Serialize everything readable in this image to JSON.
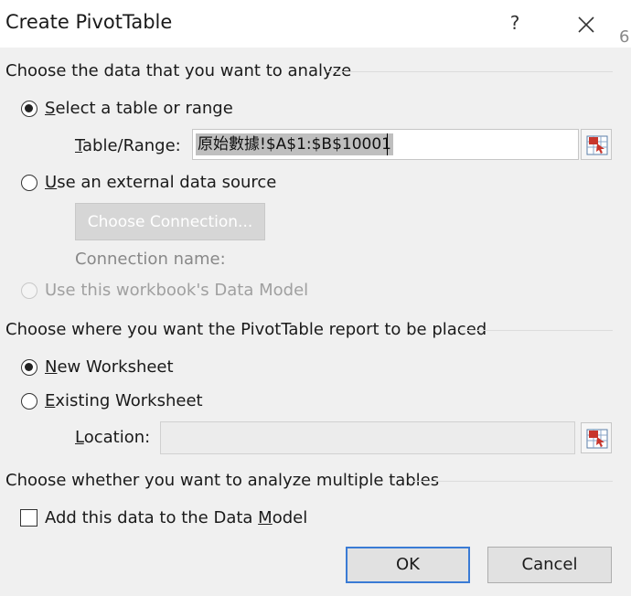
{
  "dialog": {
    "title": "Create PivotTable",
    "help_glyph": "?",
    "edge_glyph": "6"
  },
  "analyze_section": {
    "heading": "Choose the data that you want to analyze",
    "option_table": {
      "ak": "S",
      "rest": "elect a table or range",
      "selected": true
    },
    "range_label": {
      "ak": "T",
      "rest": "able/Range:"
    },
    "range_value": "原始數據!$A$1:$B$10001",
    "option_external": {
      "pre": "",
      "ak": "U",
      "rest": "se an external data source",
      "selected": false
    },
    "connection_button": "Choose Connection...",
    "connection_name_label": "Connection name:",
    "option_data_model": {
      "label": "Use this workbook's Data Model",
      "enabled": false
    }
  },
  "placement_section": {
    "heading": "Choose where you want the PivotTable report to be placed",
    "option_new": {
      "ak": "N",
      "rest": "ew Worksheet",
      "selected": true
    },
    "option_existing": {
      "ak": "E",
      "rest": "xisting Worksheet",
      "selected": false
    },
    "location_label": {
      "ak": "L",
      "rest": "ocation:"
    },
    "location_value": ""
  },
  "multiple_section": {
    "heading": "Choose whether you want to analyze multiple tables",
    "checkbox_pre": "Add this data to the Data ",
    "checkbox_ak": "M",
    "checkbox_rest": "odel",
    "checked": false
  },
  "buttons": {
    "ok": "OK",
    "cancel": "Cancel"
  },
  "colors": {
    "accent": "#3a7bd5",
    "background": "#f0f0f0",
    "range_picker_red": "#c8352b"
  }
}
